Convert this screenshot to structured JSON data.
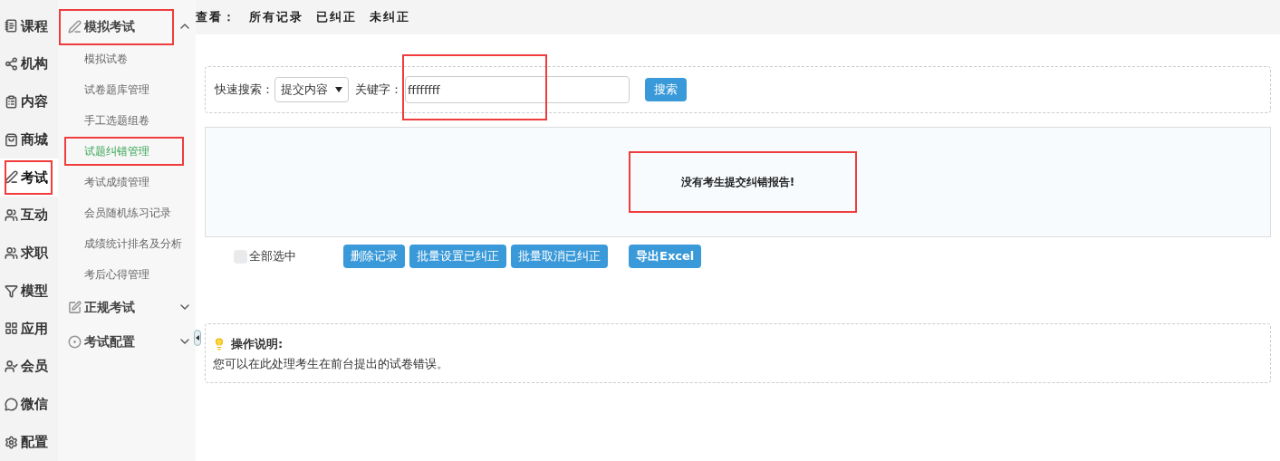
{
  "rail": [
    {
      "label": "课程",
      "kind": "book",
      "selected": false,
      "highlighted": false
    },
    {
      "label": "机构",
      "kind": "share",
      "selected": false,
      "highlighted": false
    },
    {
      "label": "内容",
      "kind": "clipboard",
      "selected": false,
      "highlighted": false
    },
    {
      "label": "商城",
      "kind": "shop",
      "selected": false,
      "highlighted": false
    },
    {
      "label": "考试",
      "kind": "pen",
      "selected": true,
      "highlighted": true
    },
    {
      "label": "互动",
      "kind": "users",
      "selected": false,
      "highlighted": false
    },
    {
      "label": "求职",
      "kind": "users",
      "selected": false,
      "highlighted": false
    },
    {
      "label": "模型",
      "kind": "funnel",
      "selected": false,
      "highlighted": false
    },
    {
      "label": "应用",
      "kind": "grid",
      "selected": false,
      "highlighted": false
    },
    {
      "label": "会员",
      "kind": "member",
      "selected": false,
      "highlighted": false
    },
    {
      "label": "微信",
      "kind": "chat",
      "selected": false,
      "highlighted": false
    },
    {
      "label": "配置",
      "kind": "gear",
      "selected": false,
      "highlighted": false
    }
  ],
  "menu": [
    {
      "label": "模拟考试",
      "kind": "pen",
      "expanded": true,
      "highlighted": true,
      "children": [
        {
          "label": "模拟试卷",
          "selected": false,
          "highlighted": false
        },
        {
          "label": "试卷题库管理",
          "selected": false,
          "highlighted": false
        },
        {
          "label": "手工选题组卷",
          "selected": false,
          "highlighted": false
        },
        {
          "label": "试题纠错管理",
          "selected": true,
          "highlighted": true
        },
        {
          "label": "考试成绩管理",
          "selected": false,
          "highlighted": false
        },
        {
          "label": "会员随机练习记录",
          "selected": false,
          "highlighted": false
        },
        {
          "label": "成绩统计排名及分析",
          "selected": false,
          "highlighted": false
        },
        {
          "label": "考后心得管理",
          "selected": false,
          "highlighted": false
        }
      ]
    },
    {
      "label": "正规考试",
      "kind": "edit",
      "expanded": false,
      "highlighted": false
    },
    {
      "label": "考试配置",
      "kind": "ball",
      "expanded": false,
      "highlighted": false
    }
  ],
  "filter_bar": {
    "label": "查看：",
    "links": [
      "所有记录",
      "已纠正",
      "未纠正"
    ]
  },
  "search": {
    "label": "快速搜索：",
    "select": "提交内容",
    "keyword_label": "关键字：",
    "keyword": "ffffffff",
    "keyword_highlighted": true,
    "button": "搜索"
  },
  "results": {
    "message": "没有考生提交纠错报告!",
    "highlighted": true
  },
  "actions": {
    "select_all": {
      "label": "全部选中",
      "checked": false
    },
    "buttons": [
      "删除记录",
      "批量设置已纠正",
      "批量取消已纠正",
      "导出Excel"
    ]
  },
  "help": {
    "title": "操作说明:",
    "text": "您可以在此处理考生在前台提出的试卷错误。"
  }
}
